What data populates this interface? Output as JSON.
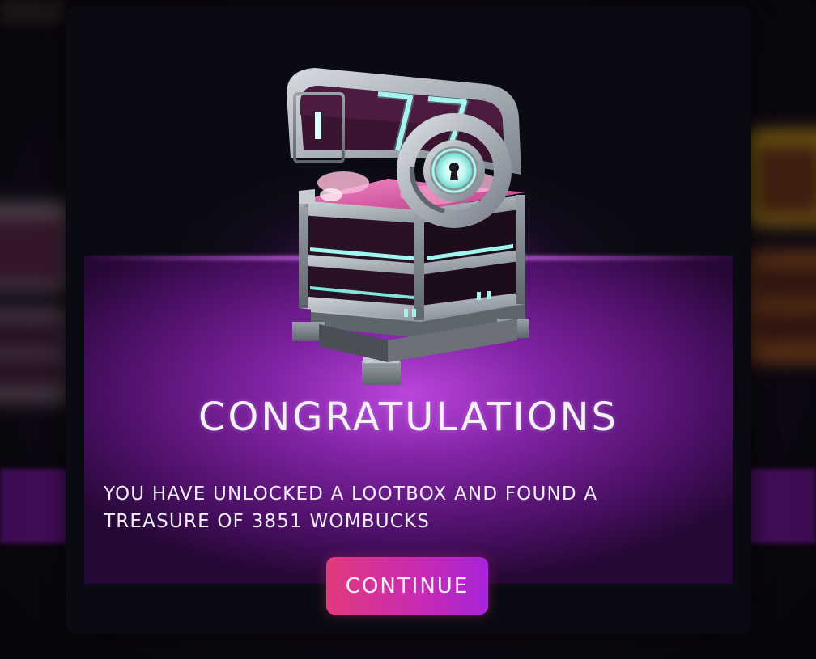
{
  "dialog": {
    "title": "CONGRATULATIONS",
    "message": "YOU HAVE UNLOCKED A LOOTBOX AND FOUND A TREASURE OF 3851 WOMBUCKS",
    "continue_label": "CONTINUE",
    "reward_amount": 3851,
    "reward_currency": "WOMBUCKS",
    "chest_icon": "lootbox-chest-open"
  },
  "colors": {
    "modal_bg": "#0a0b12",
    "glow_purple": "#c448e8",
    "button_start": "#e23a7c",
    "button_end": "#a624d8",
    "text": "#f3f0f7",
    "chest_accent": "#9ff6ef"
  }
}
